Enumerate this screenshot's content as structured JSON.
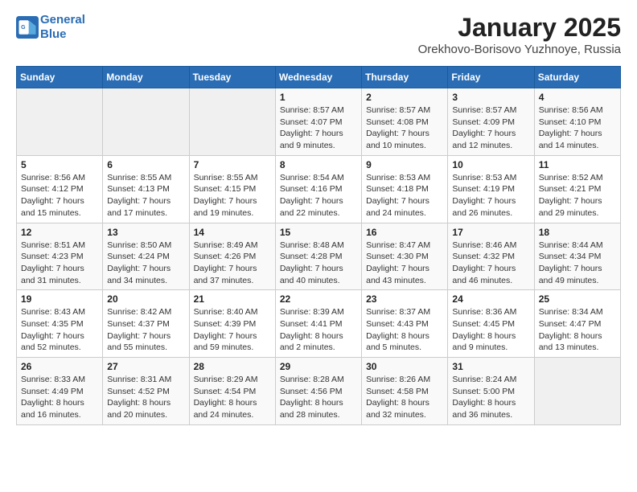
{
  "header": {
    "logo_line1": "General",
    "logo_line2": "Blue",
    "title": "January 2025",
    "subtitle": "Orekhovo-Borisovo Yuzhnoye, Russia"
  },
  "weekdays": [
    "Sunday",
    "Monday",
    "Tuesday",
    "Wednesday",
    "Thursday",
    "Friday",
    "Saturday"
  ],
  "weeks": [
    [
      {
        "day": "",
        "info": ""
      },
      {
        "day": "",
        "info": ""
      },
      {
        "day": "",
        "info": ""
      },
      {
        "day": "1",
        "info": "Sunrise: 8:57 AM\nSunset: 4:07 PM\nDaylight: 7 hours\nand 9 minutes."
      },
      {
        "day": "2",
        "info": "Sunrise: 8:57 AM\nSunset: 4:08 PM\nDaylight: 7 hours\nand 10 minutes."
      },
      {
        "day": "3",
        "info": "Sunrise: 8:57 AM\nSunset: 4:09 PM\nDaylight: 7 hours\nand 12 minutes."
      },
      {
        "day": "4",
        "info": "Sunrise: 8:56 AM\nSunset: 4:10 PM\nDaylight: 7 hours\nand 14 minutes."
      }
    ],
    [
      {
        "day": "5",
        "info": "Sunrise: 8:56 AM\nSunset: 4:12 PM\nDaylight: 7 hours\nand 15 minutes."
      },
      {
        "day": "6",
        "info": "Sunrise: 8:55 AM\nSunset: 4:13 PM\nDaylight: 7 hours\nand 17 minutes."
      },
      {
        "day": "7",
        "info": "Sunrise: 8:55 AM\nSunset: 4:15 PM\nDaylight: 7 hours\nand 19 minutes."
      },
      {
        "day": "8",
        "info": "Sunrise: 8:54 AM\nSunset: 4:16 PM\nDaylight: 7 hours\nand 22 minutes."
      },
      {
        "day": "9",
        "info": "Sunrise: 8:53 AM\nSunset: 4:18 PM\nDaylight: 7 hours\nand 24 minutes."
      },
      {
        "day": "10",
        "info": "Sunrise: 8:53 AM\nSunset: 4:19 PM\nDaylight: 7 hours\nand 26 minutes."
      },
      {
        "day": "11",
        "info": "Sunrise: 8:52 AM\nSunset: 4:21 PM\nDaylight: 7 hours\nand 29 minutes."
      }
    ],
    [
      {
        "day": "12",
        "info": "Sunrise: 8:51 AM\nSunset: 4:23 PM\nDaylight: 7 hours\nand 31 minutes."
      },
      {
        "day": "13",
        "info": "Sunrise: 8:50 AM\nSunset: 4:24 PM\nDaylight: 7 hours\nand 34 minutes."
      },
      {
        "day": "14",
        "info": "Sunrise: 8:49 AM\nSunset: 4:26 PM\nDaylight: 7 hours\nand 37 minutes."
      },
      {
        "day": "15",
        "info": "Sunrise: 8:48 AM\nSunset: 4:28 PM\nDaylight: 7 hours\nand 40 minutes."
      },
      {
        "day": "16",
        "info": "Sunrise: 8:47 AM\nSunset: 4:30 PM\nDaylight: 7 hours\nand 43 minutes."
      },
      {
        "day": "17",
        "info": "Sunrise: 8:46 AM\nSunset: 4:32 PM\nDaylight: 7 hours\nand 46 minutes."
      },
      {
        "day": "18",
        "info": "Sunrise: 8:44 AM\nSunset: 4:34 PM\nDaylight: 7 hours\nand 49 minutes."
      }
    ],
    [
      {
        "day": "19",
        "info": "Sunrise: 8:43 AM\nSunset: 4:35 PM\nDaylight: 7 hours\nand 52 minutes."
      },
      {
        "day": "20",
        "info": "Sunrise: 8:42 AM\nSunset: 4:37 PM\nDaylight: 7 hours\nand 55 minutes."
      },
      {
        "day": "21",
        "info": "Sunrise: 8:40 AM\nSunset: 4:39 PM\nDaylight: 7 hours\nand 59 minutes."
      },
      {
        "day": "22",
        "info": "Sunrise: 8:39 AM\nSunset: 4:41 PM\nDaylight: 8 hours\nand 2 minutes."
      },
      {
        "day": "23",
        "info": "Sunrise: 8:37 AM\nSunset: 4:43 PM\nDaylight: 8 hours\nand 5 minutes."
      },
      {
        "day": "24",
        "info": "Sunrise: 8:36 AM\nSunset: 4:45 PM\nDaylight: 8 hours\nand 9 minutes."
      },
      {
        "day": "25",
        "info": "Sunrise: 8:34 AM\nSunset: 4:47 PM\nDaylight: 8 hours\nand 13 minutes."
      }
    ],
    [
      {
        "day": "26",
        "info": "Sunrise: 8:33 AM\nSunset: 4:49 PM\nDaylight: 8 hours\nand 16 minutes."
      },
      {
        "day": "27",
        "info": "Sunrise: 8:31 AM\nSunset: 4:52 PM\nDaylight: 8 hours\nand 20 minutes."
      },
      {
        "day": "28",
        "info": "Sunrise: 8:29 AM\nSunset: 4:54 PM\nDaylight: 8 hours\nand 24 minutes."
      },
      {
        "day": "29",
        "info": "Sunrise: 8:28 AM\nSunset: 4:56 PM\nDaylight: 8 hours\nand 28 minutes."
      },
      {
        "day": "30",
        "info": "Sunrise: 8:26 AM\nSunset: 4:58 PM\nDaylight: 8 hours\nand 32 minutes."
      },
      {
        "day": "31",
        "info": "Sunrise: 8:24 AM\nSunset: 5:00 PM\nDaylight: 8 hours\nand 36 minutes."
      },
      {
        "day": "",
        "info": ""
      }
    ]
  ]
}
